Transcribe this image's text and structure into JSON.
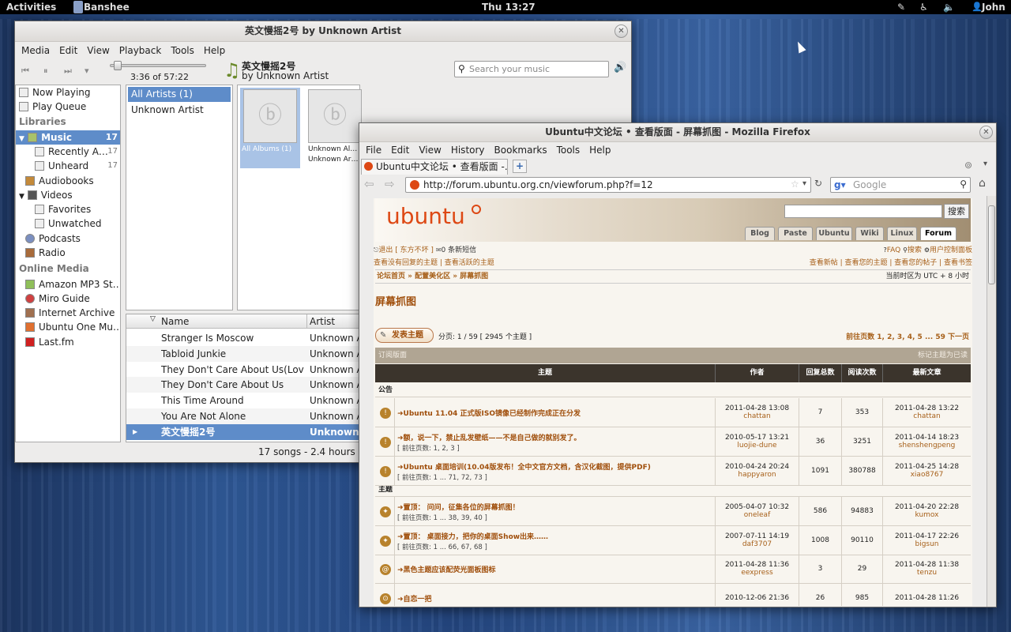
{
  "panel": {
    "activities": "Activities",
    "app": "Banshee",
    "clock": "Thu 13:27",
    "user": "John"
  },
  "banshee": {
    "title": "英文慢摇2号 by Unknown Artist",
    "menu": [
      "Media",
      "Edit",
      "View",
      "Playback",
      "Tools",
      "Help"
    ],
    "time": "3:36 of 57:22",
    "track_title": "英文慢摇2号",
    "track_artist": "by Unknown Artist",
    "search_placeholder": "Search your music",
    "sidebar": {
      "now_playing": "Now Playing",
      "play_queue": "Play Queue",
      "libraries": "Libraries",
      "music": "Music",
      "music_count": "17",
      "recently": "Recently A…",
      "recently_count": "17",
      "unheard": "Unheard",
      "unheard_count": "17",
      "audiobooks": "Audiobooks",
      "videos": "Videos",
      "favorites": "Favorites",
      "unwatched": "Unwatched",
      "podcasts": "Podcasts",
      "radio": "Radio",
      "online_media": "Online Media",
      "amazon": "Amazon MP3 St…",
      "miro": "Miro Guide",
      "archive": "Internet Archive",
      "ubuntuone": "Ubuntu One Mu…",
      "lastfm": "Last.fm"
    },
    "artists": [
      "All Artists (1)",
      "Unknown Artist"
    ],
    "albums": {
      "all": "All Albums (1)",
      "unknown1": "Unknown Al…",
      "unknown2": "Unknown Ar…"
    },
    "columns": {
      "name": "Name",
      "artist": "Artist"
    },
    "tracks": [
      {
        "name": "Stranger Is Moscow",
        "artist": "Unknown A"
      },
      {
        "name": "Tabloid Junkie",
        "artist": "Unknown A"
      },
      {
        "name": "They Don't Care About Us(Lov…",
        "artist": "Unknown A"
      },
      {
        "name": "They Don't Care About Us",
        "artist": "Unknown A"
      },
      {
        "name": "This Time Around",
        "artist": "Unknown A"
      },
      {
        "name": "You Are Not Alone",
        "artist": "Unknown A"
      },
      {
        "name": "英文慢摇2号",
        "artist": "Unknown"
      }
    ],
    "status": "17 songs - 2.4 hours -"
  },
  "firefox": {
    "title": "Ubuntu中文论坛 • 查看版面 - 屏幕抓图 - Mozilla Firefox",
    "menu": [
      "File",
      "Edit",
      "View",
      "History",
      "Bookmarks",
      "Tools",
      "Help"
    ],
    "tab": "Ubuntu中文论坛 • 查看版面 -…",
    "url": "http://forum.ubuntu.org.cn/viewforum.php?f=12",
    "search_placeholder": "Google",
    "page": {
      "logo": "ubuntu",
      "search_btn": "搜索",
      "nav": [
        "Blog",
        "Paste",
        "Ubuntu",
        "Wiki",
        "Linux",
        "Forum"
      ],
      "logout": "退出 [ 东方不坏 ]",
      "msgs": "0 条新短信",
      "faq": "FAQ",
      "search": "搜索",
      "ucp": "用户控制面板",
      "links_left": "查看没有回复的主题 | 查看活跃的主题",
      "links_right": "查看新帖 | 查看您的主题 | 查看您的帖子 | 查看书签",
      "breadcrumb": "论坛首页 » 配置美化区 » 屏幕抓图",
      "timezone": "当前时区为 UTC + 8 小时",
      "forum_title": "屏幕抓图",
      "post_btn": "发表主题",
      "pages": "分页: 1 / 59 [ 2945 个主题 ]",
      "goto": "前往页数 1, 2, 3, 4, 5 ... 59 下一页",
      "subscribe": "订阅版面",
      "mark_read": "标记主题为已读",
      "headers": [
        "主题",
        "作者",
        "回复总数",
        "阅读次数",
        "最新文章"
      ],
      "sect_announce": "公告",
      "sect_topics": "主题",
      "rows": [
        {
          "title": "➜Ubuntu 11.04 正式版ISO镜像已经制作完成正在分发",
          "pages": "",
          "date": "2011-04-28 13:08",
          "author": "chattan",
          "replies": "7",
          "views": "353",
          "ldate": "2011-04-28 13:22",
          "luser": "chattan"
        },
        {
          "title": "➜额，说一下，禁止乱发壁纸——不是自己做的就别发了。",
          "pages": "[ 前往页数: 1, 2, 3 ]",
          "date": "2010-05-17 13:21",
          "author": "luojie-dune",
          "replies": "36",
          "views": "3251",
          "ldate": "2011-04-14 18:23",
          "luser": "shenshengpeng"
        },
        {
          "title": "➜Ubuntu 桌面培训(10.04版发布！全中文官方文档，含汉化截图，提供PDF)",
          "pages": "[ 前往页数: 1 ... 71, 72, 73 ]",
          "date": "2010-04-24 20:24",
          "author": "happyaron",
          "replies": "1091",
          "views": "380788",
          "ldate": "2011-04-25 14:28",
          "luser": "xiao8767"
        },
        {
          "title": "➜置顶：  问问，征集各位的屏幕抓图！",
          "pages": "[ 前往页数: 1 ... 38, 39, 40 ]",
          "date": "2005-04-07 10:32",
          "author": "oneleaf",
          "replies": "586",
          "views": "94883",
          "ldate": "2011-04-20 22:28",
          "luser": "kumox"
        },
        {
          "title": "➜置顶：  桌面接力，把你的桌面Show出来……",
          "pages": "[ 前往页数: 1 ... 66, 67, 68 ]",
          "date": "2007-07-11 14:19",
          "author": "daf3707",
          "replies": "1008",
          "views": "90110",
          "ldate": "2011-04-17 22:26",
          "luser": "bigsun"
        },
        {
          "title": "➜黑色主题应该配荧光面板图标",
          "pages": "",
          "date": "2011-04-28 11:36",
          "author": "eexpress",
          "replies": "3",
          "views": "29",
          "ldate": "2011-04-28 11:38",
          "luser": "tenzu"
        },
        {
          "title": "➜自恋一把",
          "pages": "",
          "date": "2010-12-06 21:36",
          "author": "",
          "replies": "26",
          "views": "985",
          "ldate": "2011-04-28 11:26",
          "luser": ""
        }
      ]
    }
  }
}
